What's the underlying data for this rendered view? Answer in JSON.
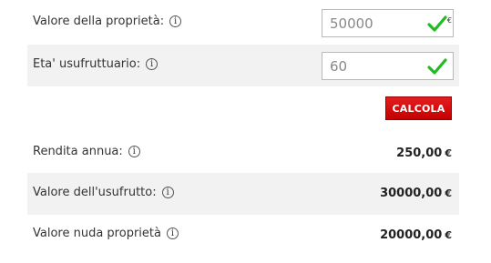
{
  "form": {
    "property_value": {
      "label": "Valore della proprietà:",
      "value": "50000",
      "currency": "€"
    },
    "usufructuary_age": {
      "label": "Eta' usufruttuario:",
      "value": "60"
    },
    "calculate_label": "CALCOLA"
  },
  "results": {
    "annual_income": {
      "label": "Rendita annua:",
      "value": "250,00",
      "currency": "€"
    },
    "usufruct_value": {
      "label": "Valore dell'usufrutto:",
      "value": "30000,00",
      "currency": "€"
    },
    "bare_property_value": {
      "label": "Valore nuda proprietà",
      "value": "20000,00",
      "currency": "€"
    }
  },
  "info_icon_glyph": "i",
  "colors": {
    "check": "#22bb22",
    "button": "#d40f0f",
    "shaded_row": "#f2f2f2"
  }
}
